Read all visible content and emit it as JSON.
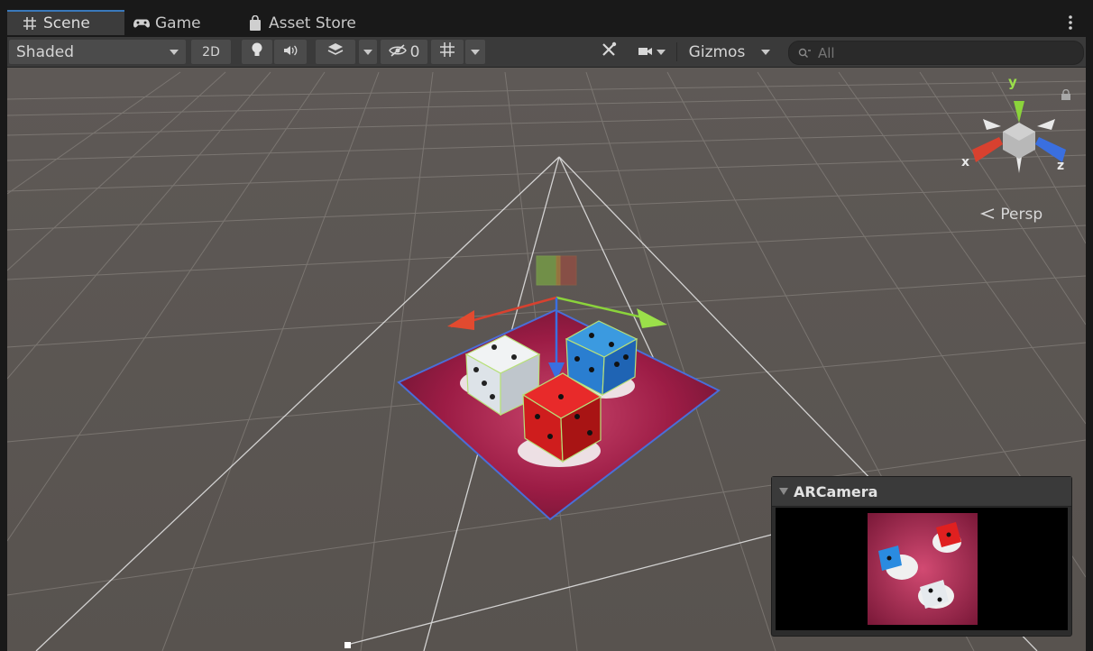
{
  "tabs": [
    {
      "label": "Scene",
      "icon": "scene-grid-icon",
      "active": true
    },
    {
      "label": "Game",
      "icon": "gamepad-icon",
      "active": false
    },
    {
      "label": "Asset Store",
      "icon": "shopping-bag-icon",
      "active": false
    }
  ],
  "toolbar": {
    "draw_mode": "Shaded",
    "mode_2d": "2D",
    "hidden_count": "0",
    "gizmos": "Gizmos",
    "search_placeholder": "All"
  },
  "scene_view": {
    "orientation_gizmo": {
      "y": "y",
      "x": "x",
      "z": "z"
    },
    "projection": "Persp"
  },
  "camera_preview": {
    "title": "ARCamera"
  },
  "colors": {
    "accent": "#3a79bb",
    "axis_x": "#d8412f",
    "axis_y": "#8bd33b",
    "axis_z": "#3a6fe0",
    "mat": "#a01f4a"
  }
}
